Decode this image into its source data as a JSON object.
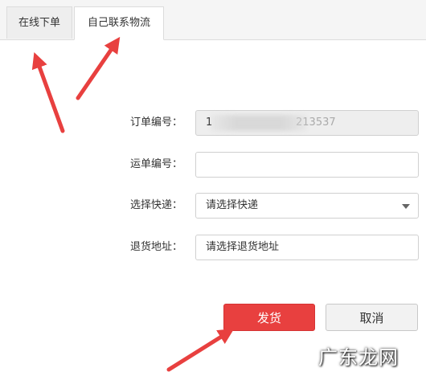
{
  "tabs": [
    {
      "label": "在线下单",
      "active": false
    },
    {
      "label": "自己联系物流",
      "active": true
    }
  ],
  "form": {
    "order_no": {
      "label": "订单编号：",
      "value_start": "1",
      "value_end": "213537"
    },
    "waybill_no": {
      "label": "运单编号：",
      "value": ""
    },
    "courier": {
      "label": "选择快递：",
      "selected": "请选择快递"
    },
    "return_address": {
      "label": "退货地址：",
      "selected": "请选择退货地址"
    }
  },
  "buttons": {
    "ship": "发货",
    "cancel": "取消"
  },
  "watermark": "广东龙网",
  "colors": {
    "primary": "#e8403f",
    "arrow": "#e8403f"
  }
}
